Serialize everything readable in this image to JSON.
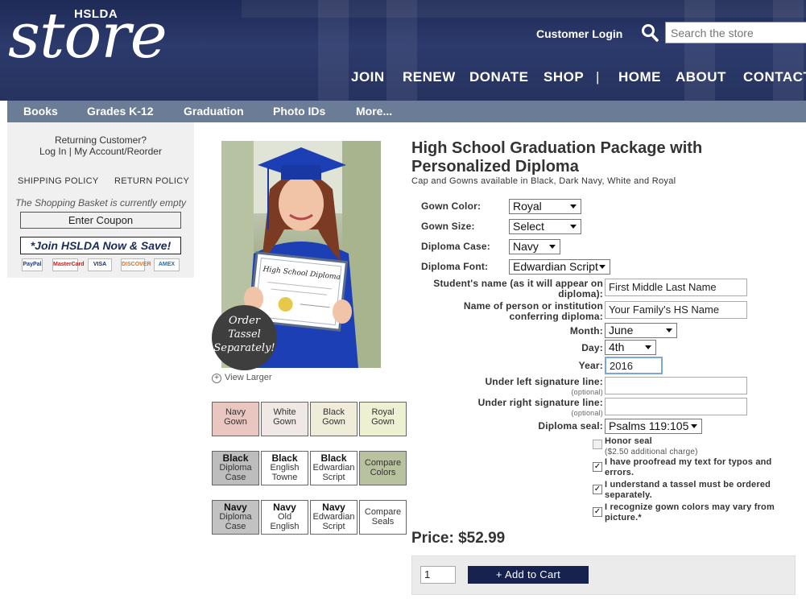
{
  "header": {
    "logo_small": "HSLDA",
    "logo_big": "store",
    "customer_login": "Customer Login",
    "search_placeholder": "Search the store",
    "nav": [
      "JOIN",
      "RENEW",
      "DONATE",
      "SHOP",
      "|",
      "HOME",
      "ABOUT",
      "CONTACT"
    ]
  },
  "subnav": [
    "Books",
    "Grades K-12",
    "Graduation",
    "Photo IDs",
    "More..."
  ],
  "sidebar": {
    "returning": "Returning Customer?",
    "login": "Log In",
    "separator": " | ",
    "account": "My Account/Reorder",
    "shipping_policy": "SHIPPING POLICY",
    "return_policy": "RETURN POLICY",
    "basket_status": "The Shopping Basket is currently empty",
    "coupon_button": "Enter Coupon",
    "join_button": "*Join HSLDA Now & Save!",
    "payment_icons": [
      "PayPal",
      "MasterCard",
      "VISA",
      "DISCOVER",
      "AMEX"
    ]
  },
  "photo": {
    "diploma_title": "High School Diploma",
    "order_tassel": [
      "Order",
      "Tassel",
      "Separately!"
    ],
    "view_larger": "View Larger"
  },
  "swatches": {
    "row1": [
      {
        "line1": "Navy",
        "line2": "Gown",
        "bg": "#e9c7c0"
      },
      {
        "line1": "White",
        "line2": "Gown",
        "bg": "#efe8e4"
      },
      {
        "line1": "Black",
        "line2": "Gown",
        "bg": "#efecd9"
      },
      {
        "line1": "Royal",
        "line2": "Gown",
        "bg": "#eef0d2"
      }
    ],
    "row2": [
      {
        "line1": "Black",
        "line2": "Diploma",
        "line3": "Case",
        "bg": "#bdbdbd"
      },
      {
        "line1": "Black",
        "line2": "English",
        "line3": "Towne",
        "bg": "#ffffff"
      },
      {
        "line1": "Black",
        "line2": "Edwardian",
        "line3": "Script",
        "bg": "#ffffff"
      },
      {
        "line1": "Compare",
        "line2": "Colors",
        "bg": "#b9c29f"
      }
    ],
    "row3": [
      {
        "line1": "Navy",
        "line2": "Diploma",
        "line3": "Case",
        "bg": "#c2c2c2"
      },
      {
        "line1": "Navy",
        "line2": "Old",
        "line3": "English",
        "bg": "#ffffff"
      },
      {
        "line1": "Navy",
        "line2": "Edwardian",
        "line3": "Script",
        "bg": "#ffffff"
      },
      {
        "line1": "Compare",
        "line2": "Seals",
        "bg": "#ffffff"
      }
    ]
  },
  "product": {
    "title": "High School Graduation Package with Personalized Diploma",
    "subtitle": "Cap and Gowns available in Black, Dark Navy, White and Royal",
    "price": "Price: $52.99"
  },
  "form": {
    "gown_color_label": "Gown Color:",
    "gown_color_value": "Royal",
    "gown_size_label": "Gown Size:",
    "gown_size_value": "Select",
    "diploma_case_label": "Diploma Case:",
    "diploma_case_value": "Navy",
    "diploma_font_label": "Diploma Font:",
    "diploma_font_value": "Edwardian Script",
    "student_name_label": "Student's name (as it will appear on diploma):",
    "student_name_value": "First Middle Last Name",
    "conferring_label": "Name of person or institution conferring diploma:",
    "conferring_value": "Your Family's HS Name",
    "month_label": "Month:",
    "month_value": "June",
    "day_label": "Day:",
    "day_value": "4th",
    "year_label": "Year:",
    "year_value": "2016",
    "left_sig_label": "Under left signature line:",
    "right_sig_label": "Under right signature line:",
    "optional": "(optional)",
    "left_sig_value": "",
    "right_sig_value": "",
    "seal_label": "Diploma seal:",
    "seal_value": "Psalms 119:105",
    "honor_seal_label": "Honor seal",
    "honor_seal_note": "($2.50 additional charge)",
    "proofread_label": "I have proofread my text for typos and errors.",
    "tassel_label": "I understand a tassel must be ordered separately.",
    "colors_label": "I recognize gown colors may vary from picture.*"
  },
  "cart": {
    "quantity": "1",
    "add_to_cart": "+ Add to Cart"
  }
}
